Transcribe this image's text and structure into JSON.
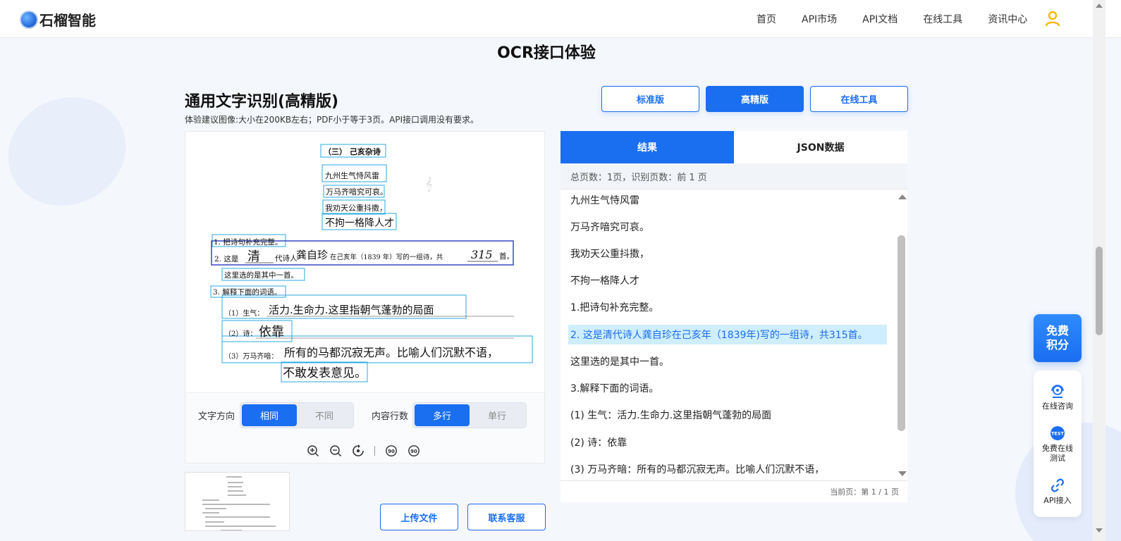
{
  "brand": {
    "name": "石榴智能"
  },
  "nav": [
    "首页",
    "API市场",
    "API文档",
    "在线工具",
    "资讯中心"
  ],
  "page_title": "OCR接口体验",
  "section": {
    "title": "通用文字识别(高精版)",
    "hint": "体验建议图像:大小在200KB左右；PDF小于等于3页。API接口调用没有要求。"
  },
  "version_buttons": {
    "standard": "标准版",
    "high": "高精版",
    "tools": "在线工具"
  },
  "document": {
    "heading": "（三）  己亥杂诗",
    "poem": [
      "九州生气恃风雷",
      "万马齐喑究可哀。",
      "我劝天公重抖擞，",
      "不拘一格降人才"
    ],
    "q1": "1. 把诗句补充完整。",
    "q2_prefix": "2. 这是",
    "q2_ans1": "清",
    "q2_mid": "代诗人",
    "q2_ans2": "龚自珍",
    "q2_text": "在己亥年（1839 年）写的一组诗，共",
    "q2_ans3": "315",
    "q2_suffix": "首。",
    "q2_line2": "这里选的是其中一首。",
    "q3": "3. 解释下面的词语。",
    "a1_label": "（1）生气：",
    "a1": "活力.生命力.这里指朝气蓬勃的局面",
    "a2_label": "（2）诗：",
    "a2": "依靠",
    "a3_label": "（3）万马齐喑：",
    "a3": "所有的马都沉寂无声。比喻人们沉默不语，",
    "a3_cont": "不敢发表意见。"
  },
  "controls": {
    "direction_label": "文字方向",
    "direction_options": [
      "相同",
      "不同"
    ],
    "rows_label": "内容行数",
    "rows_options": [
      "多行",
      "单行"
    ]
  },
  "tool_icons": [
    "zoom-in-icon",
    "zoom-out-icon",
    "rotate-icon",
    "rotate-left-90-icon",
    "rotate-right-90-icon"
  ],
  "actions": {
    "upload": "上传文件",
    "contact": "联系客服"
  },
  "results": {
    "tabs": [
      "结果",
      "JSON数据"
    ],
    "summary": "总页数：1页，识别页数：前 1 页",
    "lines": [
      "九州生气恃风雷",
      "万马齐喑究可哀。",
      "我劝天公重抖擞，",
      "不拘一格降人才",
      "1.把诗句补充完整。",
      "2. 这是清代诗人龚自珍在己亥年（1839年)写的一组诗，共315首。",
      "这里选的是其中一首。",
      "3.解释下面的词语。",
      "(1) 生气：活力.生命力.这里指朝气蓬勃的局面",
      "(2) 诗：依靠",
      "(3) 万马齐暗：所有的马都沉寂无声。比喻人们沉默不语，"
    ],
    "highlighted_index": 5,
    "pager": "当前页：第 1 / 1 页"
  },
  "float": {
    "free_points": "免费\n积分",
    "consult": "在线咨询",
    "free_test": "免费在线测试",
    "api": "API接入"
  },
  "colors": {
    "accent": "#1a6ef0",
    "highlight": "#cfeeff",
    "box": "#29a8e0"
  }
}
